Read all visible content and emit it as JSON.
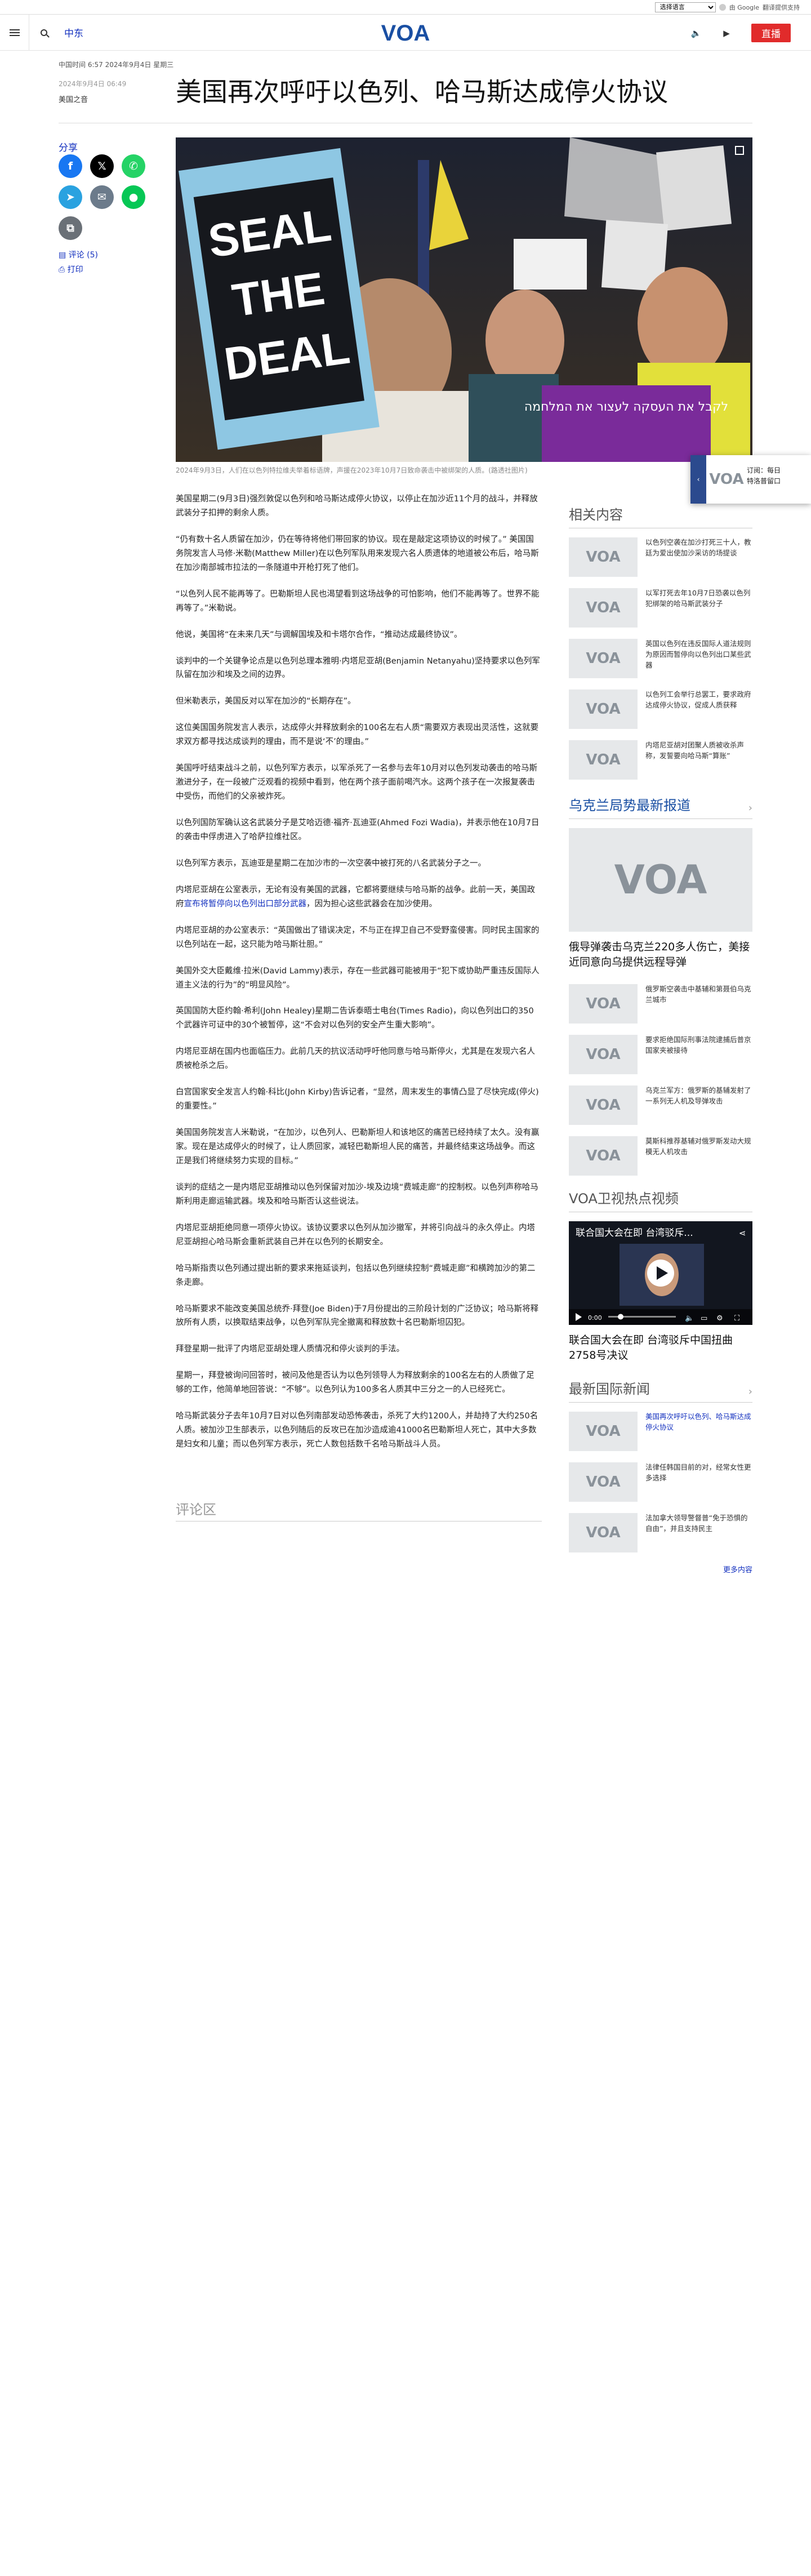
{
  "topbar": {
    "language_select": "选择语言",
    "powered_by": "由 Google",
    "translate": "翻译提供支持"
  },
  "header": {
    "section": "中东",
    "logo_text": "VOA",
    "live_label": "直播"
  },
  "meta_strip": "中国时间 6:57 2024年9月4日 星期三",
  "article": {
    "date": "2024年9月4日 06:49",
    "author": "美国之音",
    "title": "美国再次呼吁以色列、哈马斯达成停火协议",
    "caption": "2024年9月3日，人们在以色列特拉维夫举着标语牌，声援在2023年10月7日致命袭击中被绑架的人质。(路透社图片)",
    "poster_text": [
      "SEAL",
      "THE",
      "DEAL"
    ],
    "banner_text": "לקבל את העסקה לעצור את המלחמה",
    "paragraphs": [
      "美国星期二(9月3日)强烈敦促以色列和哈马斯达成停火协议，以停止在加沙近11个月的战斗，并释放武装分子扣押的剩余人质。",
      "“仍有数十名人质留在加沙，仍在等待将他们带回家的协议。现在是敲定这项协议的时候了。” 美国国务院发言人马修·米勒(Matthew Miller)在以色列军队用来发现六名人质遗体的地道被公布后，哈马斯在加沙南部城市拉法的一条隧道中开枪打死了他们。",
      "“以色列人民不能再等了。巴勒斯坦人民也渴望看到这场战争的可怕影响，他们不能再等了。世界不能再等了。”米勒说。",
      "他说，美国将“在未来几天”与调解国埃及和卡塔尔合作，“推动达成最终协议”。",
      "谈判中的一个关键争论点是以色列总理本雅明·内塔尼亚胡(Benjamin Netanyahu)坚持要求以色列军队留在加沙和埃及之间的边界。",
      "但米勒表示，美国反对以军在加沙的“长期存在”。",
      "这位美国国务院发言人表示，达成停火并释放剩余的100名左右人质“需要双方表现出灵活性，这就要求双方都寻找达成谈判的理由，而不是说‘不’的理由。”",
      "美国呼吁结束战斗之前，以色列军方表示，以军杀死了一名参与去年10月对以色列发动袭击的哈马斯激进分子，在一段被广泛观看的视频中看到，他在两个孩子面前喝汽水。这两个孩子在一次报复袭击中受伤，而他们的父亲被炸死。",
      "以色列国防军确认这名武装分子是艾哈迈德·福齐·瓦迪亚(Ahmed Fozi Wadia)，并表示他在10月7日的袭击中俘虏进入了哈萨拉维社区。",
      "以色列军方表示，瓦迪亚是星期二在加沙市的一次空袭中被打死的八名武装分子之一。",
      "内塔尼亚胡在公室表示，无论有没有美国的武器，它都将要继续与哈马斯的战争。此前一天，美国政府宣布将暂停向以色列出口部分武器，因为担心这些武器会在加沙使用。",
      "内塔尼亚胡的办公室表示：“英国做出了错误决定，不与正在捍卫自己不受野蛮侵害。同时民主国家的以色列站在一起，这只能为哈马斯壮胆。”",
      "美国外交大臣戴维·拉米(David Lammy)表示，存在一些武器可能被用于“犯下或协助严重违反国际人道主义法的行为”的“明显风险”。",
      "英国国防大臣约翰·希利(John Healey)星期二告诉泰晤士电台(Times Radio)，向以色列出口的350个武器许可证中的30个被暂停，这“不会对以色列的安全产生重大影响”。",
      "内塔尼亚胡在国内也面临压力。此前几天的抗议活动呼吁他同意与哈马斯停火，尤其是在发现六名人质被枪杀之后。",
      "白宫国家安全发言人约翰·科比(John Kirby)告诉记者，“显然，周末发生的事情凸显了尽快完成(停火)的重要性。”",
      "美国国务院发言人米勒说，“在加沙，以色列人、巴勒斯坦人和该地区的痛苦已经持续了太久。没有赢家。现在是达成停火的时候了，让人质回家，减轻巴勒斯坦人民的痛苦，并最终结束这场战争。而这正是我们将继续努力实现的目标。”",
      "谈判的症结之一是内塔尼亚胡推动以色列保留对加沙-埃及边境“费城走廊”的控制权。以色列声称哈马斯利用走廊运输武器。埃及和哈马斯否认这些说法。",
      "内塔尼亚胡拒绝同意一项停火协议。该协议要求以色列从加沙撤军，并将引向战斗的永久停止。内塔尼亚胡担心哈马斯会重新武装自己并在以色列的长期安全。",
      "哈马斯指责以色列通过提出新的要求来拖延谈判，包括以色列继续控制“费城走廊”和横跨加沙的第二条走廊。",
      "哈马斯要求不能改变美国总统乔·拜登(Joe Biden)于7月份提出的三阶段计划的广泛协议；哈马斯将释放所有人质，以换取结束战争，以色列军队完全撤离和释放数十名巴勒斯坦囚犯。",
      "拜登星期一批评了内塔尼亚胡处理人质情况和停火谈判的手法。",
      "星期一，拜登被询问回答时，被问及他是否认为以色列领导人为释放剩余的100名左右的人质做了足够的工作，他简单地回答说：“不够”。以色列认为100多名人质其中三分之一的人已经死亡。",
      "哈马斯武装分子去年10月7日对以色列南部发动恐怖袭击，杀死了大约1200人，并劫持了大约250名人质。被加沙卫生部表示，以色列随后的反攻已在加沙造成逾41000名巴勒斯坦人死亡，其中大多数是妇女和儿童；而以色列军方表示，死亡人数包括数千名哈马斯战斗人员。"
    ],
    "link_text": "宣布将暂停向以色列出口部分武器",
    "comments_title": "评论区"
  },
  "share": {
    "label": "分享",
    "comments": "评论 (5)",
    "print": "打印"
  },
  "related": {
    "title": "相关内容",
    "items": [
      "以色列空袭在加沙打死三十人，教廷为爱出使加沙采访的场提谈",
      "以军打死去年10月7日恐袭以色列犯绑架的哈马斯武装分子",
      "英国以色列在违反国际人道法规则为原因而暂停向以色列出口某些武器",
      "以色列工会举行总罢工，要求政府达成停火协议，促成人质获释",
      "内塔尼亚胡对团聚人质被收杀声称，发誓要向哈马斯“算账”"
    ]
  },
  "ukraine": {
    "title": "乌克兰局势最新报道",
    "big_caption": "俄导弹袭击乌克兰220多人伤亡，美接近同意向乌提供远程导弹",
    "items": [
      "俄罗斯空袭击中基辅和第聂伯乌克兰城市",
      "要求拒绝国际刑事法院逮捕后普京国家夹被接待",
      "乌克兰军方：俄罗斯的基辅发射了一系列无人机及导弹攻击",
      "莫斯科推荐基辅对俄罗斯发动大规模无人机攻击"
    ]
  },
  "voa_video": {
    "title": "VOA卫视热点视频",
    "overlay_title": "联合国大会在即 台湾驳斥...",
    "time": "0:00",
    "caption": "联合国大会在即 台湾驳斥中国扭曲2758号决议"
  },
  "intl_news": {
    "title": "最新国际新闻",
    "items": [
      "美国再次呼吁以色列、哈马斯达成停火协议",
      "法律任韩国目前的对，经常女性更多选择",
      "法加拿大领导警督普“免于恐惧的自由”，并且支持民主"
    ],
    "more": "更多内容"
  },
  "floating_widget": {
    "text_line1": "订阅：每日",
    "text_line2": "特洛普留口"
  },
  "colors": {
    "brand_blue": "#1330bf",
    "live_red": "#e12b2b"
  }
}
